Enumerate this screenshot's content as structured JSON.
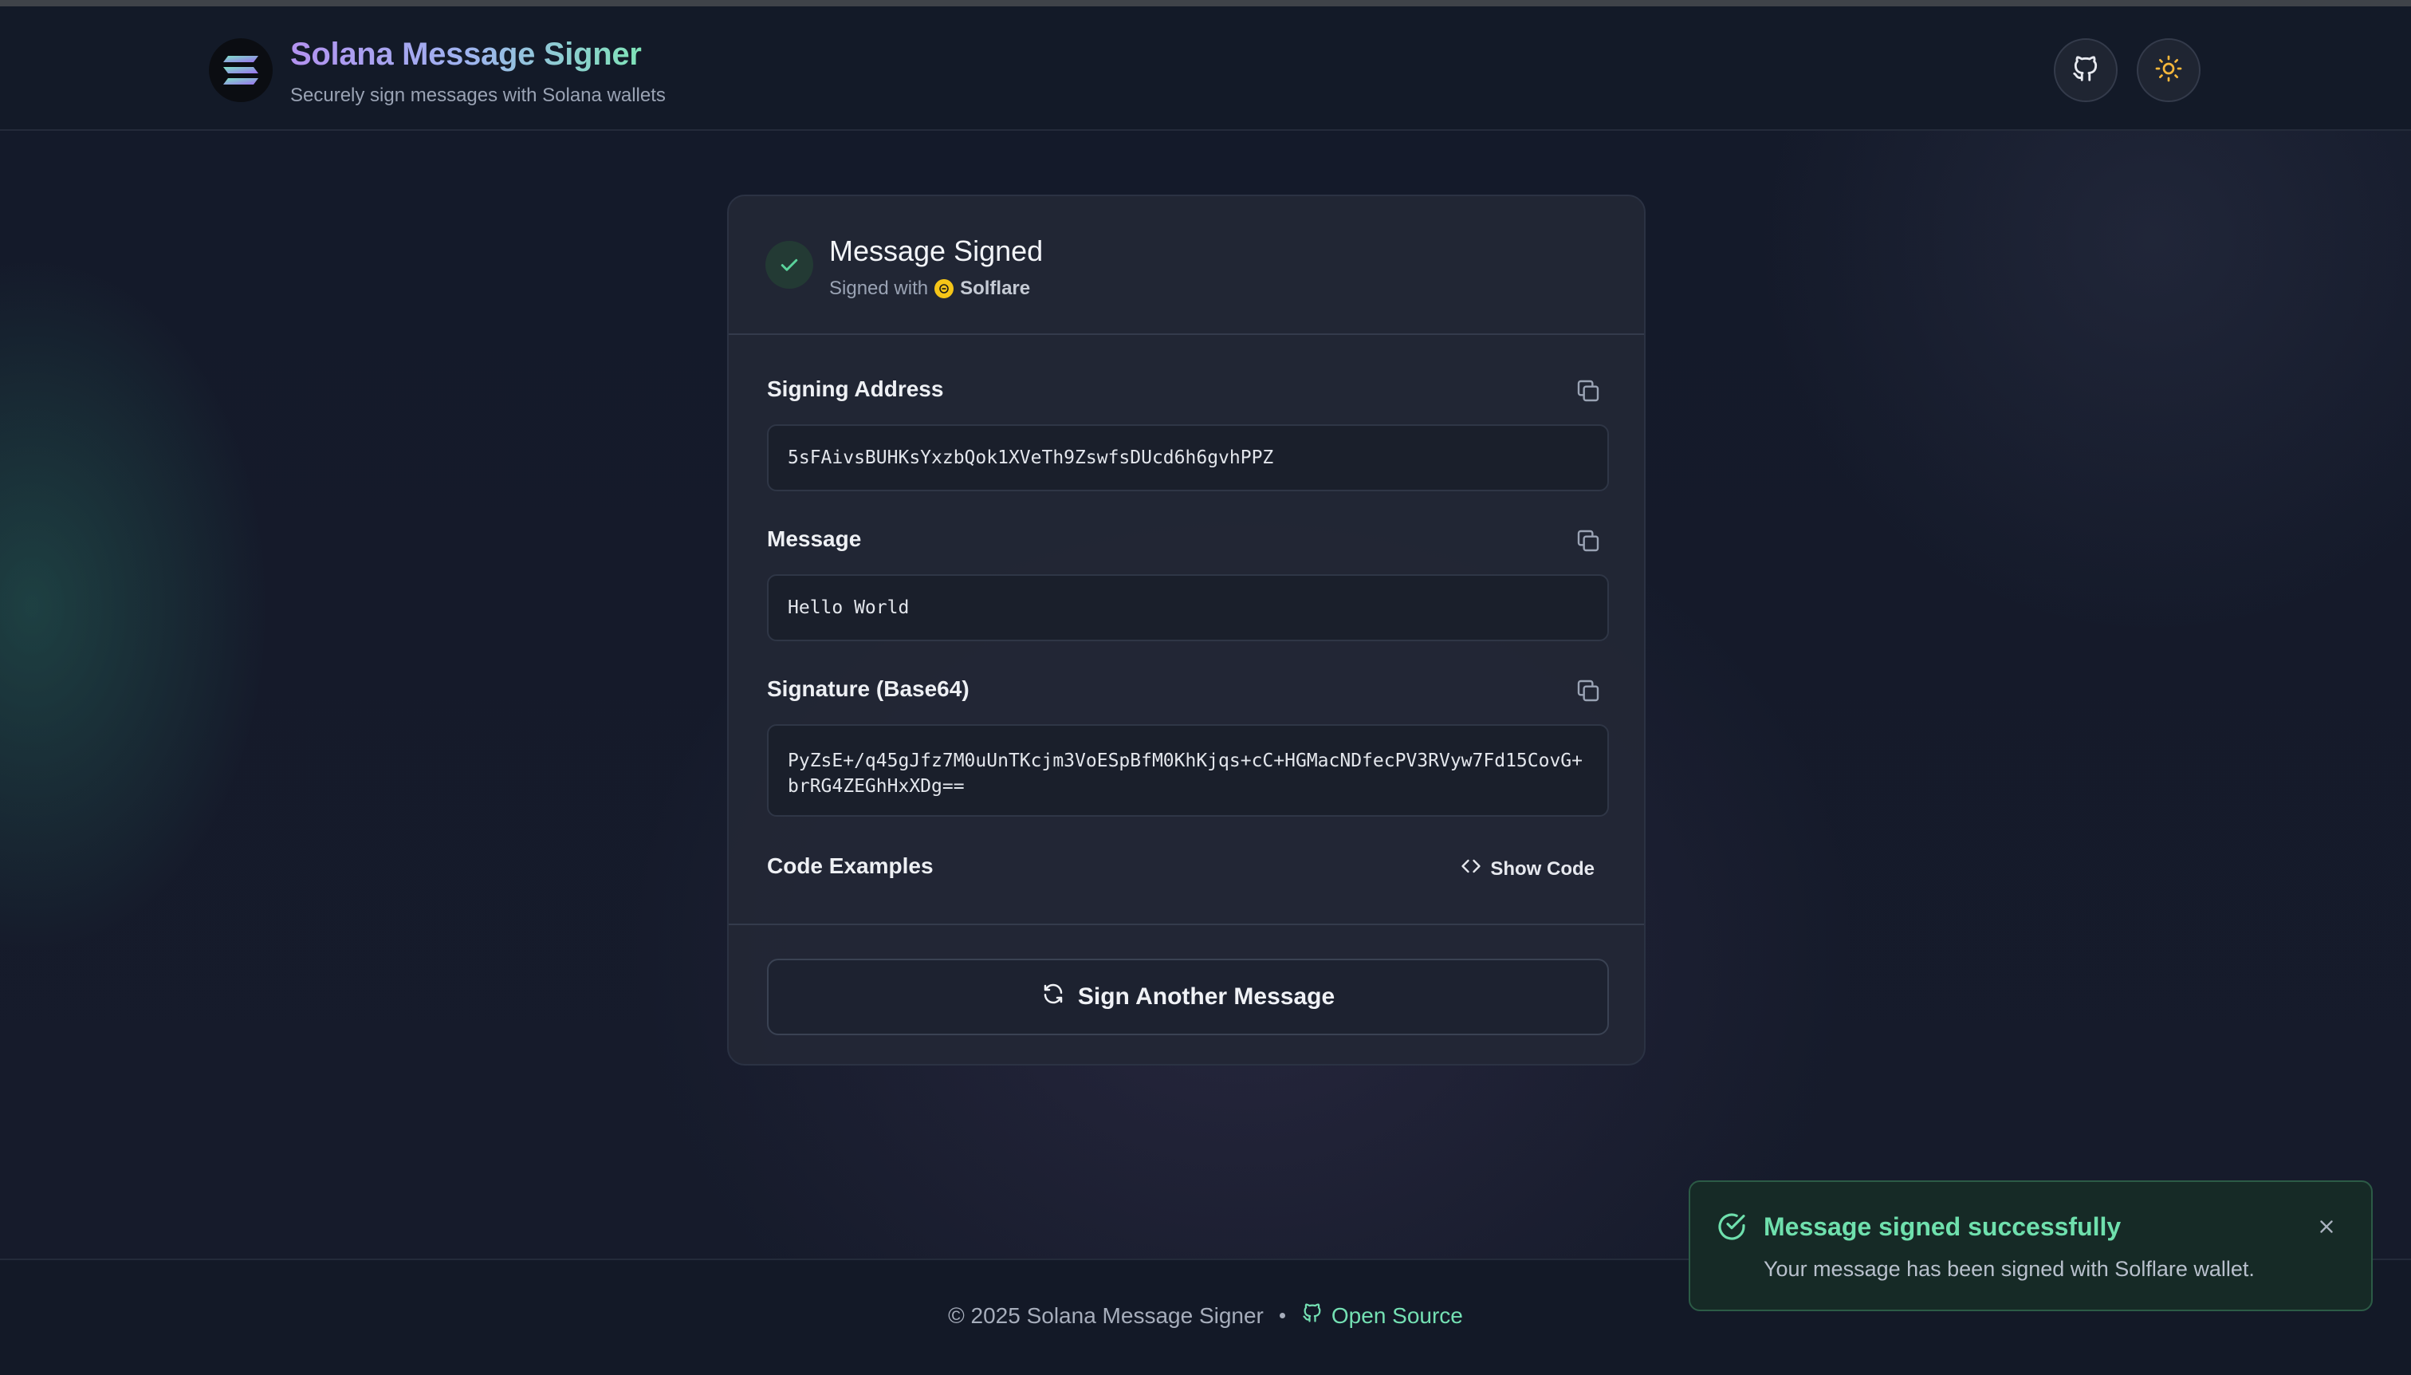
{
  "header": {
    "title": "Solana Message Signer",
    "subtitle": "Securely sign messages with Solana wallets",
    "logo_icon": "solana-logo-icon",
    "github_icon": "github-icon",
    "theme_icon": "sun-icon"
  },
  "card": {
    "title": "Message Signed",
    "signed_with_label": "Signed with",
    "wallet_name": "Solflare",
    "fields": {
      "address_label": "Signing Address",
      "address_value": "5sFAivsBUHKsYxzbQok1XVeTh9ZswfsDUcd6h6gvhPPZ",
      "message_label": "Message",
      "message_value": "Hello World",
      "signature_label": "Signature (Base64)",
      "signature_value": "PyZsE+/q45gJfz7M0uUnTKcjm3VoESpBfM0KhKjqs+cC+HGMacNDfecPV3RVyw7Fd15CovG+brRG4ZEGhHxXDg=="
    },
    "code_examples_label": "Code Examples",
    "show_code_label": "Show Code",
    "sign_another_label": "Sign Another Message"
  },
  "footer": {
    "copyright": "© 2025 Solana Message Signer",
    "link_label": "Open Source"
  },
  "toast": {
    "title": "Message signed successfully",
    "message": "Your message has been signed with Solflare wallet."
  },
  "colors": {
    "accent_green": "#6fe0ad",
    "brand_purple": "#b392f0",
    "background": "#141a29",
    "card": "#222735"
  }
}
